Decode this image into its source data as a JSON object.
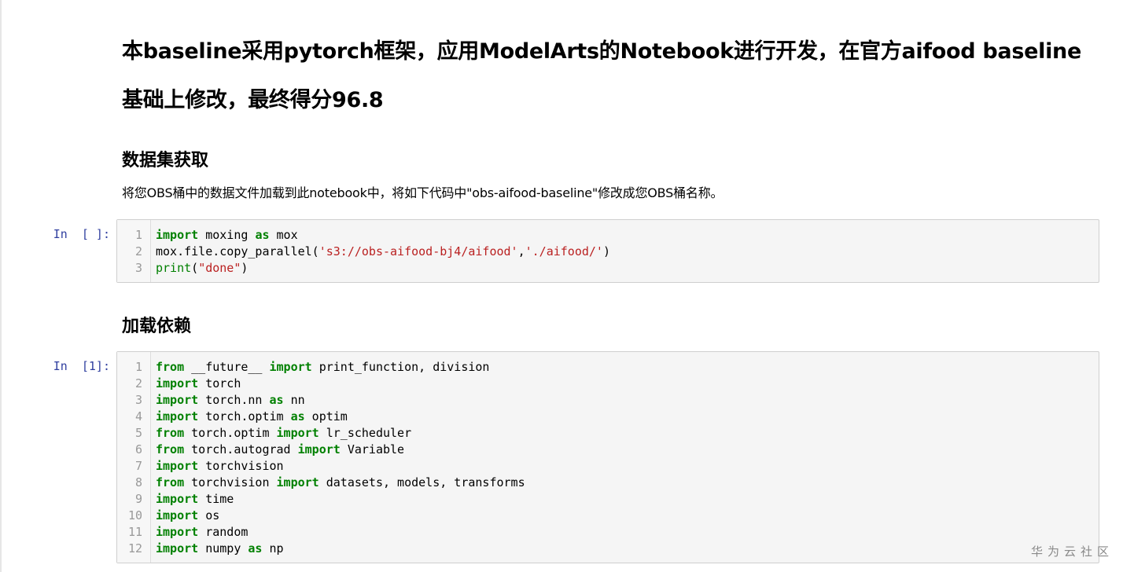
{
  "markdown": {
    "title_line1": "本baseline采用pytorch框架，应用ModelArts的Notebook进行开发，在官方aifood baseline",
    "title_line2": "基础上修改，最终得分96.8",
    "section1_heading": "数据集获取",
    "section1_text": "将您OBS桶中的数据文件加载到此notebook中，将如下代码中\"obs-aifood-baseline\"修改成您OBS桶名称。",
    "section2_heading": "加载依赖"
  },
  "cells": [
    {
      "prompt": "In  [ ]:",
      "lines": [
        [
          {
            "t": "import",
            "c": "kw"
          },
          {
            "t": " moxing "
          },
          {
            "t": "as",
            "c": "kw"
          },
          {
            "t": " mox"
          }
        ],
        [
          {
            "t": "mox.file.copy_parallel("
          },
          {
            "t": "'s3://obs-aifood-bj4/aifood'",
            "c": "st"
          },
          {
            "t": ","
          },
          {
            "t": "'./aifood/'",
            "c": "st"
          },
          {
            "t": ")"
          }
        ],
        [
          {
            "t": "print",
            "c": "bi"
          },
          {
            "t": "("
          },
          {
            "t": "\"done\"",
            "c": "st"
          },
          {
            "t": ")"
          }
        ]
      ]
    },
    {
      "prompt": "In  [1]:",
      "lines": [
        [
          {
            "t": "from",
            "c": "kw"
          },
          {
            "t": " __future__ "
          },
          {
            "t": "import",
            "c": "kw"
          },
          {
            "t": " print_function, division"
          }
        ],
        [
          {
            "t": "import",
            "c": "kw"
          },
          {
            "t": " torch"
          }
        ],
        [
          {
            "t": "import",
            "c": "kw"
          },
          {
            "t": " torch.nn "
          },
          {
            "t": "as",
            "c": "kw"
          },
          {
            "t": " nn"
          }
        ],
        [
          {
            "t": "import",
            "c": "kw"
          },
          {
            "t": " torch.optim "
          },
          {
            "t": "as",
            "c": "kw"
          },
          {
            "t": " optim"
          }
        ],
        [
          {
            "t": "from",
            "c": "kw"
          },
          {
            "t": " torch.optim "
          },
          {
            "t": "import",
            "c": "kw"
          },
          {
            "t": " lr_scheduler"
          }
        ],
        [
          {
            "t": "from",
            "c": "kw"
          },
          {
            "t": " torch.autograd "
          },
          {
            "t": "import",
            "c": "kw"
          },
          {
            "t": " Variable"
          }
        ],
        [
          {
            "t": "import",
            "c": "kw"
          },
          {
            "t": " torchvision"
          }
        ],
        [
          {
            "t": "from",
            "c": "kw"
          },
          {
            "t": " torchvision "
          },
          {
            "t": "import",
            "c": "kw"
          },
          {
            "t": " datasets, models, transforms"
          }
        ],
        [
          {
            "t": "import",
            "c": "kw"
          },
          {
            "t": " time"
          }
        ],
        [
          {
            "t": "import",
            "c": "kw"
          },
          {
            "t": " os"
          }
        ],
        [
          {
            "t": "import",
            "c": "kw"
          },
          {
            "t": " random"
          }
        ],
        [
          {
            "t": "import",
            "c": "kw"
          },
          {
            "t": " numpy "
          },
          {
            "t": "as",
            "c": "kw"
          },
          {
            "t": " np"
          }
        ]
      ]
    }
  ],
  "watermark": "华为云社区",
  "colors": {
    "keyword": "#008000",
    "string": "#ba2121",
    "prompt": "#303f9f",
    "cell_bg": "#f5f5f5"
  }
}
